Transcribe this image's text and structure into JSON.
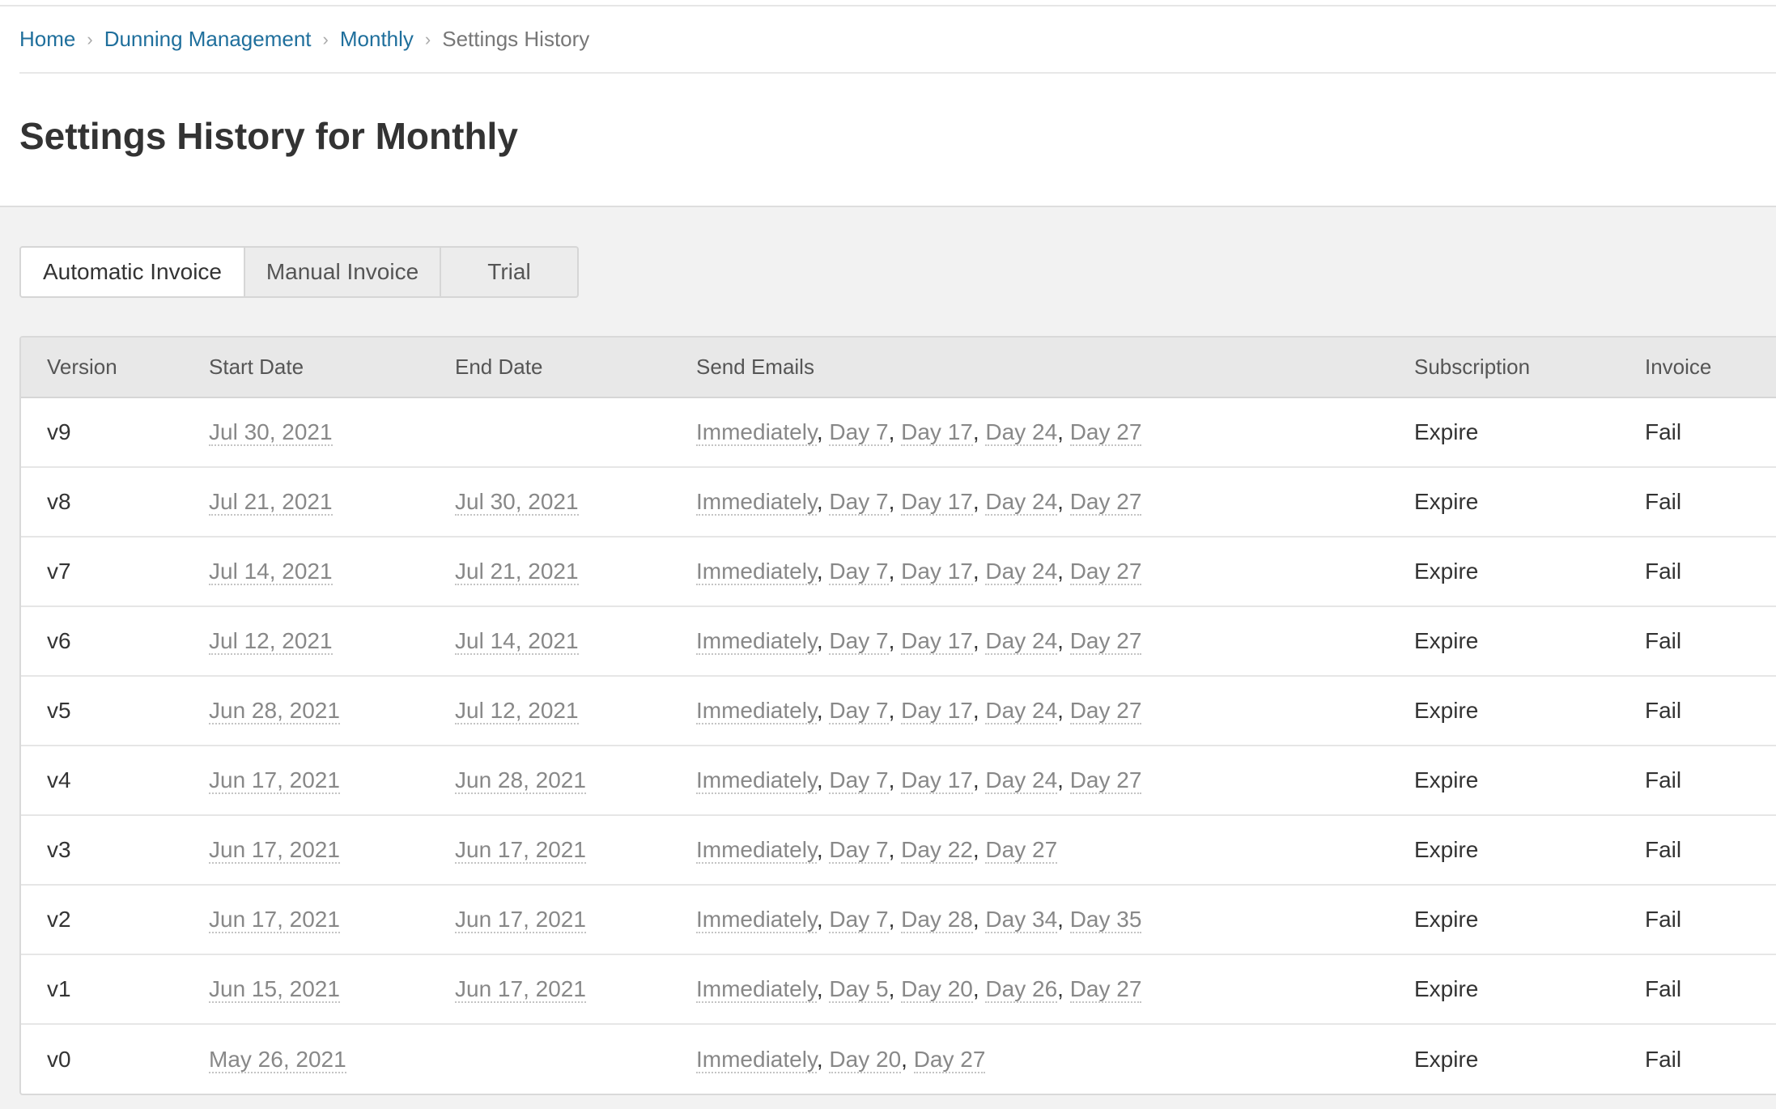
{
  "breadcrumb": {
    "items": [
      "Home",
      "Dunning Management",
      "Monthly"
    ],
    "current": "Settings History",
    "separator": "›"
  },
  "page_title": "Settings History for Monthly",
  "tabs": [
    {
      "label": "Automatic Invoice",
      "active": true
    },
    {
      "label": "Manual Invoice",
      "active": false
    },
    {
      "label": "Trial",
      "active": false
    }
  ],
  "table": {
    "headers": [
      "Version",
      "Start Date",
      "End Date",
      "Send Emails",
      "Subscription",
      "Invoice"
    ],
    "rows": [
      {
        "version": "v9",
        "start": "Jul 30, 2021",
        "end": "",
        "emails": [
          "Immediately",
          "Day 7",
          "Day 17",
          "Day 24",
          "Day 27"
        ],
        "subscription": "Expire",
        "invoice": "Fail"
      },
      {
        "version": "v8",
        "start": "Jul 21, 2021",
        "end": "Jul 30, 2021",
        "emails": [
          "Immediately",
          "Day 7",
          "Day 17",
          "Day 24",
          "Day 27"
        ],
        "subscription": "Expire",
        "invoice": "Fail"
      },
      {
        "version": "v7",
        "start": "Jul 14, 2021",
        "end": "Jul 21, 2021",
        "emails": [
          "Immediately",
          "Day 7",
          "Day 17",
          "Day 24",
          "Day 27"
        ],
        "subscription": "Expire",
        "invoice": "Fail"
      },
      {
        "version": "v6",
        "start": "Jul 12, 2021",
        "end": "Jul 14, 2021",
        "emails": [
          "Immediately",
          "Day 7",
          "Day 17",
          "Day 24",
          "Day 27"
        ],
        "subscription": "Expire",
        "invoice": "Fail"
      },
      {
        "version": "v5",
        "start": "Jun 28, 2021",
        "end": "Jul 12, 2021",
        "emails": [
          "Immediately",
          "Day 7",
          "Day 17",
          "Day 24",
          "Day 27"
        ],
        "subscription": "Expire",
        "invoice": "Fail"
      },
      {
        "version": "v4",
        "start": "Jun 17, 2021",
        "end": "Jun 28, 2021",
        "emails": [
          "Immediately",
          "Day 7",
          "Day 17",
          "Day 24",
          "Day 27"
        ],
        "subscription": "Expire",
        "invoice": "Fail"
      },
      {
        "version": "v3",
        "start": "Jun 17, 2021",
        "end": "Jun 17, 2021",
        "emails": [
          "Immediately",
          "Day 7",
          "Day 22",
          "Day 27"
        ],
        "subscription": "Expire",
        "invoice": "Fail"
      },
      {
        "version": "v2",
        "start": "Jun 17, 2021",
        "end": "Jun 17, 2021",
        "emails": [
          "Immediately",
          "Day 7",
          "Day 28",
          "Day 34",
          "Day 35"
        ],
        "subscription": "Expire",
        "invoice": "Fail"
      },
      {
        "version": "v1",
        "start": "Jun 15, 2021",
        "end": "Jun 17, 2021",
        "emails": [
          "Immediately",
          "Day 5",
          "Day 20",
          "Day 26",
          "Day 27"
        ],
        "subscription": "Expire",
        "invoice": "Fail"
      },
      {
        "version": "v0",
        "start": "May 26, 2021",
        "end": "",
        "emails": [
          "Immediately",
          "Day 20",
          "Day 27"
        ],
        "subscription": "Expire",
        "invoice": "Fail"
      }
    ]
  },
  "colors": {
    "link": "#1f6f9c",
    "muted_value": "#888888",
    "page_background": "#f2f2f2",
    "table_header_background": "#e8e8e8"
  }
}
